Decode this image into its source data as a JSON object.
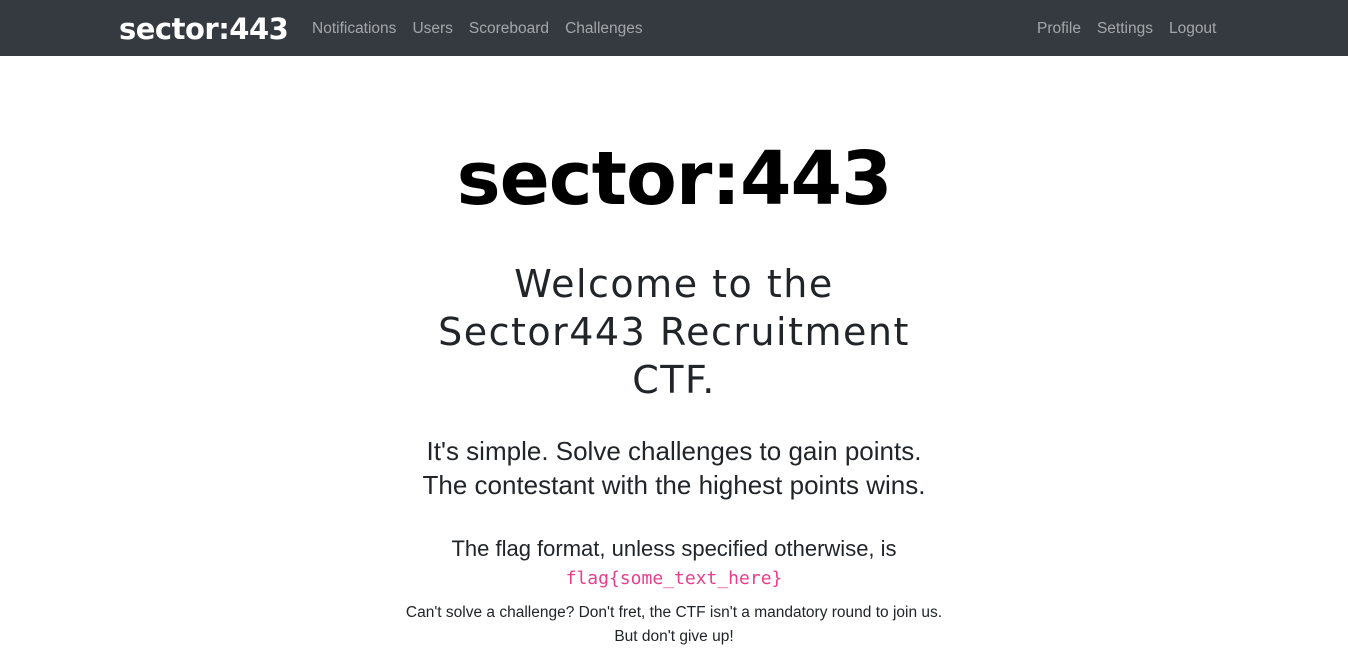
{
  "navbar": {
    "brand": "sector:443",
    "left_links": [
      "Notifications",
      "Users",
      "Scoreboard",
      "Challenges"
    ],
    "right_links": [
      "Profile",
      "Settings",
      "Logout"
    ]
  },
  "main": {
    "hero_title": "sector:443",
    "welcome_line1": "Welcome to the",
    "welcome_line2": "Sector443 Recruitment",
    "welcome_line3": "CTF.",
    "intro_line1": "It's simple. Solve challenges to gain points.",
    "intro_line2": "The contestant with the highest points wins.",
    "flag_text": "The flag format, unless specified otherwise, is",
    "flag_code": "flag{some_text_here}",
    "note_line1": "Can't solve a challenge? Don't fret, the CTF isn't a mandatory round to join us.",
    "note_line2": "But don't give up!"
  },
  "colors": {
    "navbar_bg": "#343a40",
    "code_pink": "#e83e8c"
  }
}
